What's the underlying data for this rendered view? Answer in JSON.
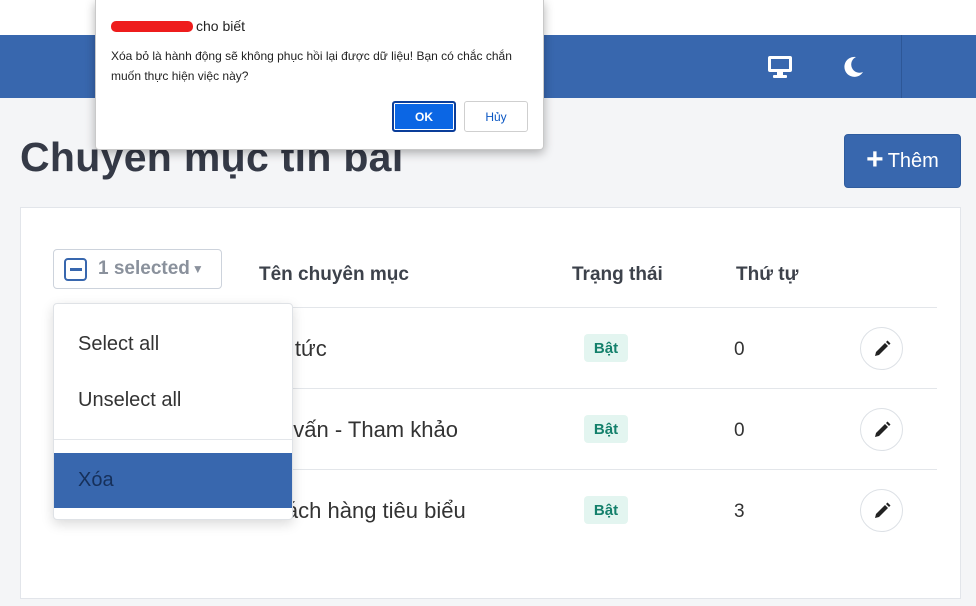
{
  "header": {
    "monitor_icon": "monitor-icon",
    "theme_icon": "moon-icon",
    "bar_color": "#3867ae"
  },
  "page": {
    "title": "Chuyen mục tin bài",
    "add_label": "Thêm"
  },
  "bulk": {
    "selected_label": "1 selected",
    "menu": {
      "select_all": "Select all",
      "unselect_all": "Unselect all",
      "delete": "Xóa"
    }
  },
  "table": {
    "columns": {
      "name": "Tên chuyên mục",
      "status": "Trạng thái",
      "order": "Thứ tự"
    },
    "rows": [
      {
        "name": "Tin tức",
        "status": "Bật",
        "order": "0"
      },
      {
        "name": "Tư vấn - Tham khảo",
        "status": "Bật",
        "order": "0"
      },
      {
        "name": "Khách hàng tiêu biểu",
        "status": "Bật",
        "order": "3"
      }
    ]
  },
  "alert": {
    "title_suffix": "cho biết",
    "message": "Xóa bỏ là hành động sẽ không phục hồi lại được dữ liệu! Bạn có chắc chắn muốn thực hiện việc này?",
    "ok_label": "OK",
    "cancel_label": "Hủy"
  }
}
